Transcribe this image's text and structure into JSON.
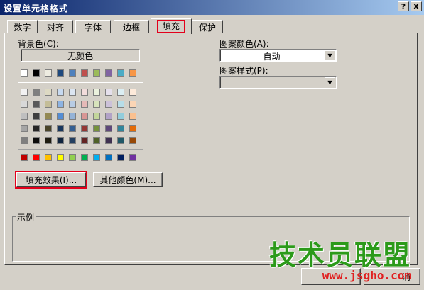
{
  "window": {
    "title": "设置单元格格式",
    "help_button": "?",
    "close_button": "X"
  },
  "tabs": [
    {
      "label": "数字"
    },
    {
      "label": "对齐"
    },
    {
      "label": "字体"
    },
    {
      "label": "边框"
    },
    {
      "label": "填充",
      "active": true
    },
    {
      "label": "保护"
    }
  ],
  "fill": {
    "background_label": "背景色(C):",
    "no_color_button": "无颜色",
    "fill_effects_button": "填充效果(I)...",
    "more_colors_button": "其他颜色(M)...",
    "pattern_color_label": "图案颜色(A):",
    "pattern_color_value": "自动",
    "pattern_style_label": "图案样式(P):",
    "pattern_style_value": "",
    "sample_label": "示例"
  },
  "palette": {
    "theme_row": [
      "#ffffff",
      "#000000",
      "#eeece1",
      "#1f497d",
      "#4f81bd",
      "#c0504d",
      "#9bbb59",
      "#8064a2",
      "#4bacc6",
      "#f79646"
    ],
    "tint_rows": [
      [
        "#f2f2f2",
        "#7f7f7f",
        "#ddd9c3",
        "#c6d9f0",
        "#dbe5f1",
        "#f2dcdb",
        "#ebf1dd",
        "#e5e0ec",
        "#dbeef3",
        "#fdeada"
      ],
      [
        "#d8d8d8",
        "#595959",
        "#c4bd97",
        "#8db3e2",
        "#b8cce4",
        "#e5b9b7",
        "#d7e3bc",
        "#ccc1d9",
        "#b7dde8",
        "#fbd5b5"
      ],
      [
        "#bfbfbf",
        "#3f3f3f",
        "#938953",
        "#548dd4",
        "#95b3d7",
        "#d99694",
        "#c3d69b",
        "#b2a2c7",
        "#92cddc",
        "#fac08f"
      ],
      [
        "#a5a5a5",
        "#262626",
        "#494429",
        "#17365d",
        "#366092",
        "#953734",
        "#76923c",
        "#5f497a",
        "#31859b",
        "#e36c09"
      ],
      [
        "#7f7f7f",
        "#0c0c0c",
        "#1d1b10",
        "#0f243e",
        "#244061",
        "#632423",
        "#4f6128",
        "#3f3151",
        "#205867",
        "#974806"
      ]
    ],
    "standard_row": [
      "#c00000",
      "#ff0000",
      "#ffc000",
      "#ffff00",
      "#92d050",
      "#00b050",
      "#00b0f0",
      "#0070c0",
      "#002060",
      "#7030a0"
    ]
  },
  "footer": {
    "cancel_button": "消"
  },
  "watermark": {
    "brand": "技术员联盟",
    "url": "www.jsgho.com"
  },
  "colors": {
    "titlebar_start": "#0a246a",
    "highlight": "#e3001b",
    "face": "#d4d0c8"
  }
}
